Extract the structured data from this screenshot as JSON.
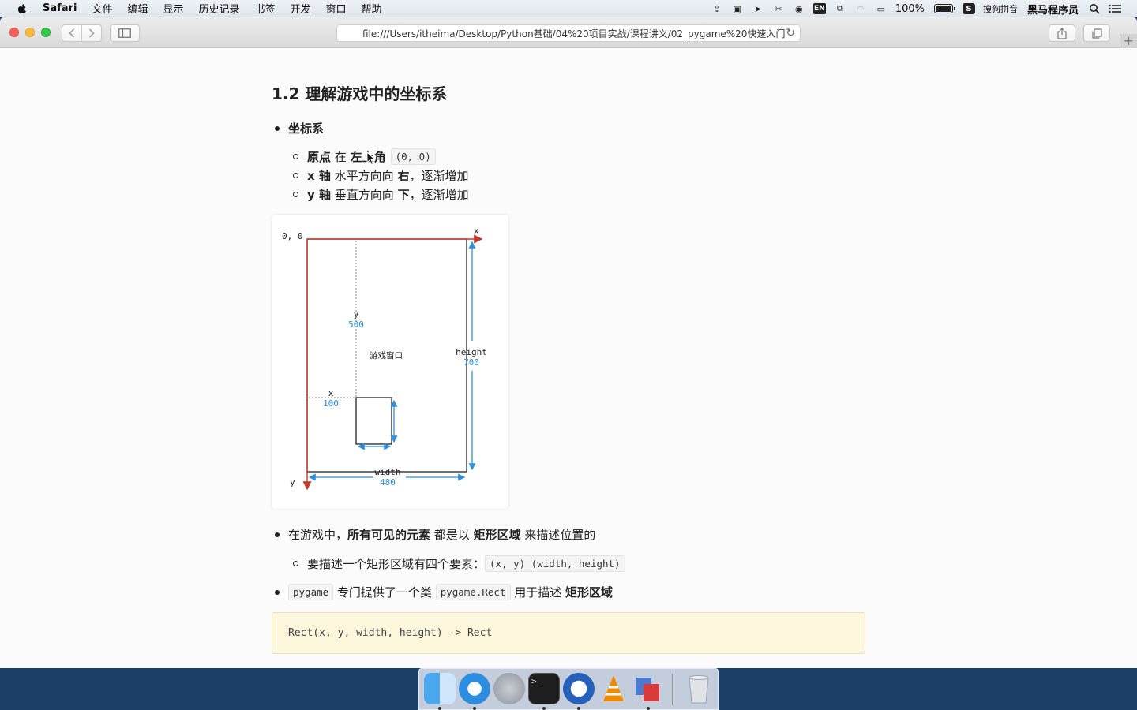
{
  "menubar": {
    "app_name": "Safari",
    "items": [
      "文件",
      "编辑",
      "显示",
      "历史记录",
      "书签",
      "开发",
      "窗口",
      "帮助"
    ],
    "battery_percent": "100%",
    "input_method": "搜狗拼音",
    "user": "黑马程序员",
    "status_icons": [
      "upload-icon",
      "video-icon",
      "send-icon",
      "scissors-icon",
      "u-icon",
      "en-icon",
      "screen-icon",
      "wifi-icon",
      "airplay-icon"
    ],
    "en_label": "EN"
  },
  "browser": {
    "url": "file:///Users/itheima/Desktop/Python基础/04%20项目实战/课程讲义/02_pygame%20快速入门"
  },
  "article": {
    "heading": "1.2 理解游戏中的坐标系",
    "bullet1": "坐标系",
    "sub1": {
      "a": "原点",
      "b": " 在 ",
      "c": "左上角",
      "code": "(0, 0)"
    },
    "sub2": {
      "a": "x 轴",
      "b": " 水平方向向 ",
      "c": "右",
      "d": "，逐渐增加"
    },
    "sub3": {
      "a": "y 轴",
      "b": " 垂直方向向 ",
      "c": "下",
      "d": "，逐渐增加"
    },
    "bullet2": {
      "a": "在游戏中，",
      "b": "所有可见的元素",
      "c": " 都是以 ",
      "d": "矩形区域",
      "e": " 来描述位置的"
    },
    "sub4": {
      "a": "要描述一个矩形区域有四个要素：",
      "code": "(x, y) (width, height)"
    },
    "bullet3": {
      "code1": "pygame",
      "a": " 专门提供了一个类 ",
      "code2": "pygame.Rect",
      "b": " 用于描述 ",
      "c": "矩形区域"
    },
    "code_block": "Rect(x, y, width, height) -> Rect"
  },
  "figure": {
    "origin": "0, 0",
    "x_axis": "x",
    "y_axis": "y",
    "y_label": "y",
    "y_value": "500",
    "x_label": "x",
    "x_value": "100",
    "window_label": "游戏窗口",
    "height_label": "height",
    "height_value": "700",
    "width_label": "width",
    "width_value": "480",
    "colors": {
      "axis": "#c0392b",
      "measure": "#2f8fd8",
      "frame": "#222222"
    }
  },
  "dock": {
    "apps": [
      "finder-icon",
      "safari-icon",
      "launchpad-icon",
      "terminal-icon",
      "xmind-icon",
      "vlc-icon",
      "parallels-icon",
      "trash-icon"
    ]
  }
}
